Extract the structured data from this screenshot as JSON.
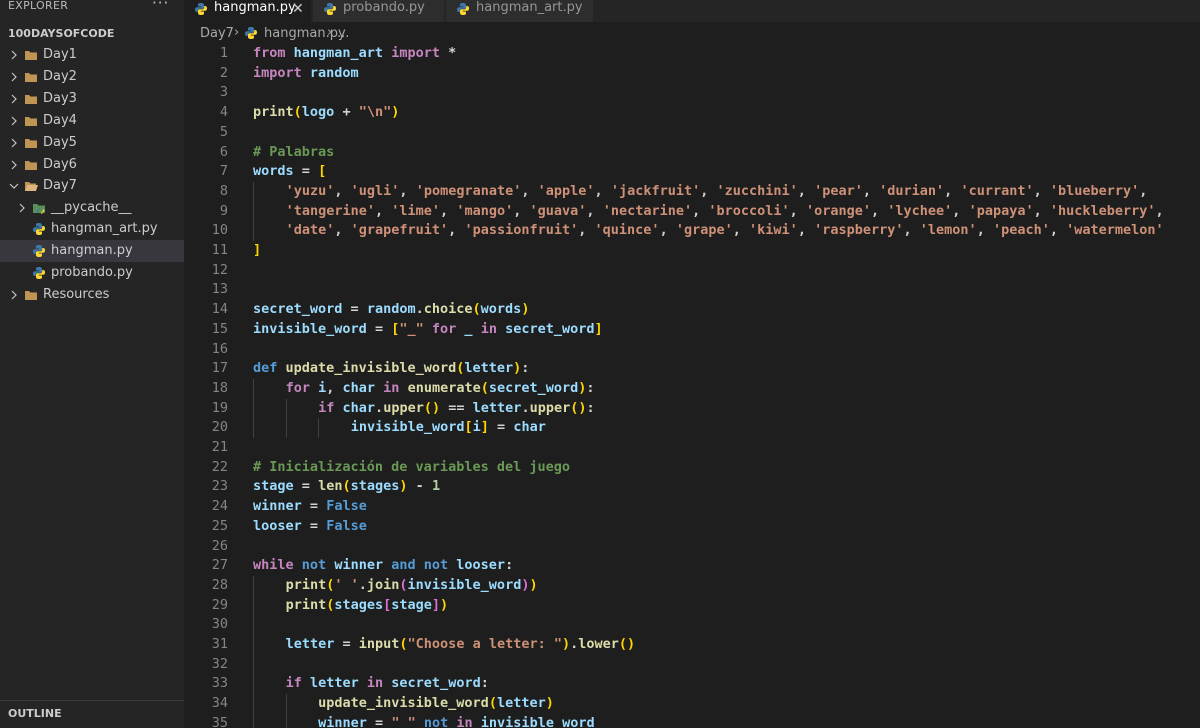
{
  "explorer": {
    "title": "EXPLORER",
    "more": "···",
    "folder": "100DAYSOFCODE",
    "items": [
      {
        "label": "Day1",
        "type": "folder"
      },
      {
        "label": "Day2",
        "type": "folder"
      },
      {
        "label": "Day3",
        "type": "folder"
      },
      {
        "label": "Day4",
        "type": "folder"
      },
      {
        "label": "Day5",
        "type": "folder"
      },
      {
        "label": "Day6",
        "type": "folder"
      },
      {
        "label": "Day7",
        "type": "folder-open"
      },
      {
        "label": "__pycache__",
        "type": "pycache"
      },
      {
        "label": "hangman_art.py",
        "type": "python"
      },
      {
        "label": "hangman.py",
        "type": "python"
      },
      {
        "label": "probando.py",
        "type": "python"
      },
      {
        "label": "Resources",
        "type": "folder"
      }
    ],
    "outline": "OUTLINE"
  },
  "tabs": [
    {
      "label": "hangman.py",
      "active": true,
      "close": "✕"
    },
    {
      "label": "probando.py",
      "active": false
    },
    {
      "label": "hangman_art.py",
      "active": false
    }
  ],
  "breadcrumb": {
    "folder": "Day7",
    "sep": "›",
    "file": "hangman.py",
    "symbol": "..."
  },
  "editor": {
    "line_numbers": [
      "1",
      "2",
      "3",
      "4",
      "5",
      "6",
      "7",
      "8",
      "9",
      "10",
      "11",
      "12",
      "13",
      "14",
      "15",
      "16",
      "17",
      "18",
      "19",
      "20",
      "21",
      "22",
      "23",
      "24",
      "25",
      "26",
      "27",
      "28",
      "29",
      "30",
      "31",
      "32",
      "33",
      "34",
      "35"
    ],
    "lines": [
      "from hangman_art import *",
      "import random",
      "",
      "print(logo + \"\\n\")",
      "",
      "# Palabras",
      "words = [",
      "    'yuzu', 'ugli', 'pomegranate', 'apple', 'jackfruit', 'zucchini', 'pear', 'durian', 'currant', 'blueberry',",
      "    'tangerine', 'lime', 'mango', 'guava', 'nectarine', 'broccoli', 'orange', 'lychee', 'papaya', 'huckleberry',",
      "    'date', 'grapefruit', 'passionfruit', 'quince', 'grape', 'kiwi', 'raspberry', 'lemon', 'peach', 'watermelon'",
      "]",
      "",
      "",
      "secret_word = random.choice(words)",
      "invisible_word = [\"_\" for _ in secret_word]",
      "",
      "def update_invisible_word(letter):",
      "    for i, char in enumerate(secret_word):",
      "        if char.upper() == letter.upper():",
      "            invisible_word[i] = char",
      "",
      "# Inicialización de variables del juego",
      "stage = len(stages) - 1",
      "winner = False",
      "looser = False",
      "",
      "while not winner and not looser:",
      "    print(' '.join(invisible_word))",
      "    print(stages[stage])",
      "",
      "    letter = input(\"Choose a letter: \").lower()",
      "",
      "    if letter in secret_word:",
      "        update_invisible_word(letter)",
      "        winner = \" \" not in invisible_word"
    ]
  },
  "colors": {
    "keyword": "#c586c0",
    "keyword_blue": "#569cd6",
    "function": "#dcdcaa",
    "variable": "#9cdcfe",
    "string": "#ce9178",
    "number": "#b5cea8",
    "comment": "#6a9955",
    "editor_bg": "#1e1e1e",
    "sidebar_bg": "#252526"
  }
}
